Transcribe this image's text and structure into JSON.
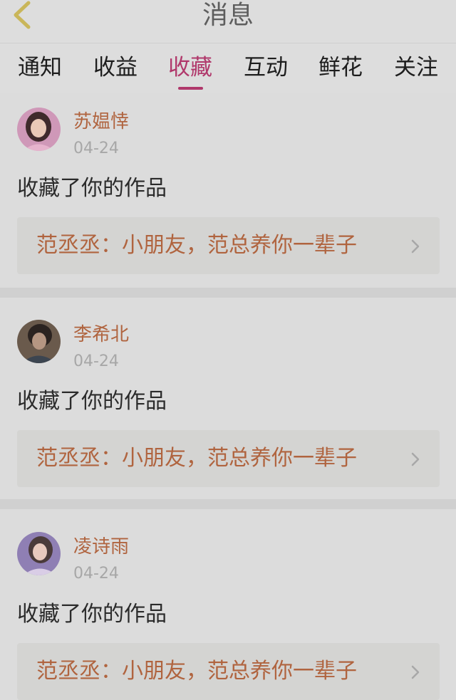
{
  "header": {
    "title": "消息"
  },
  "tabs": [
    {
      "label": "通知"
    },
    {
      "label": "收益"
    },
    {
      "label": "收藏"
    },
    {
      "label": "互动"
    },
    {
      "label": "鲜花"
    },
    {
      "label": "关注"
    }
  ],
  "active_tab_index": 2,
  "notifications": [
    {
      "user": "苏媪悻",
      "date": "04-24",
      "action": "收藏了你的作品",
      "work": "范丞丞：小朋友，范总养你一辈子"
    },
    {
      "user": "李希北",
      "date": "04-24",
      "action": "收藏了你的作品",
      "work": "范丞丞：小朋友，范总养你一辈子"
    },
    {
      "user": "凌诗雨",
      "date": "04-24",
      "action": "收藏了你的作品",
      "work": "范丞丞：小朋友，范总养你一辈子"
    }
  ],
  "colors": {
    "accent": "#b0386b",
    "username": "#b0643f",
    "back_icon": "#c9b65a"
  },
  "icons": {
    "back": "chevron-left-icon",
    "item_arrow": "chevron-right-icon"
  }
}
